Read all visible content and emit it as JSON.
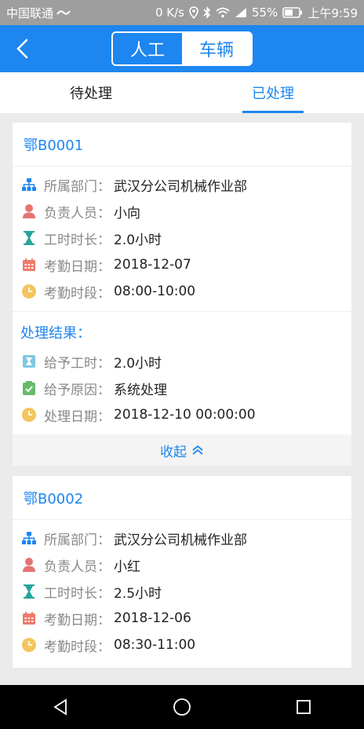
{
  "status": {
    "carrier": "中国联通",
    "speed": "0 K/s",
    "battery": "55%",
    "time": "上午9:59"
  },
  "nav": {
    "seg_left": "人工",
    "seg_right": "车辆"
  },
  "tabs": [
    {
      "label": "待处理"
    },
    {
      "label": "已处理"
    }
  ],
  "cards": [
    {
      "title": "鄂B0001",
      "rows": [
        {
          "label": "所属部门：",
          "value": "武汉分公司机械作业部"
        },
        {
          "label": "负责人员：",
          "value": "小向"
        },
        {
          "label": "工时时长：",
          "value": "2.0小时"
        },
        {
          "label": "考勤日期：",
          "value": "2018-12-07"
        },
        {
          "label": "考勤时段：",
          "value": "08:00-10:00"
        }
      ],
      "result_title": "处理结果：",
      "result_rows": [
        {
          "label": "给予工时：",
          "value": "2.0小时"
        },
        {
          "label": "给予原因：",
          "value": "系统处理"
        },
        {
          "label": "处理日期：",
          "value": "2018-12-10 00:00:00"
        }
      ],
      "collapse_label": "收起"
    },
    {
      "title": "鄂B0002",
      "rows": [
        {
          "label": "所属部门：",
          "value": "武汉分公司机械作业部"
        },
        {
          "label": "负责人员：",
          "value": "小红"
        },
        {
          "label": "工时时长：",
          "value": "2.5小时"
        },
        {
          "label": "考勤日期：",
          "value": "2018-12-06"
        },
        {
          "label": "考勤时段：",
          "value": "08:30-11:00"
        }
      ]
    }
  ],
  "colors": {
    "primary": "#1d86f0",
    "dept_icon": "#1d86f0",
    "person_icon": "#e57373",
    "hourglass_icon": "#26a69a",
    "calendar_icon": "#ef7b6b",
    "clock_icon": "#f3c55c",
    "reason_icon": "#66bb6a"
  }
}
